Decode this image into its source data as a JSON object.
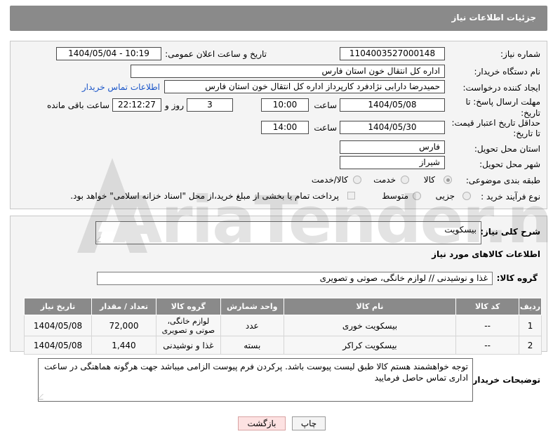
{
  "header": {
    "title": "جزئیات اطلاعات نیاز"
  },
  "fields": {
    "need_number_label": "شماره نیاز:",
    "need_number": "1104003527000148",
    "announce_label": "تاریخ و ساعت اعلان عمومی:",
    "announce_value": "1404/05/04 - 10:19",
    "buyer_org_label": "نام دستگاه خریدار:",
    "buyer_org": "اداره کل انتقال خون استان فارس",
    "creator_label": "ایجاد کننده درخواست:",
    "creator": "حمیدرضا دارابی نژادفرد کارپرداز اداره کل انتقال خون استان فارس",
    "contact_link": "اطلاعات تماس خریدار",
    "deadline_label_1": "مهلت ارسال پاسخ: تا",
    "deadline_label_2": "تاریخ:",
    "deadline_date": "1404/05/08",
    "time_label": "ساعت",
    "deadline_time": "10:00",
    "days_value": "3",
    "days_label": "روز و",
    "remaining_time": "22:12:27",
    "remaining_label": "ساعت باقی مانده",
    "min_validity_label_1": "حداقل تاریخ اعتبار قیمت:",
    "min_validity_label_2": "تا تاریخ:",
    "validity_date": "1404/05/30",
    "validity_time": "14:00",
    "province_label": "استان محل تحویل:",
    "province": "فارس",
    "city_label": "شهر محل تحویل:",
    "city": "شیراز",
    "category_label": "طبقه بندی موضوعی:",
    "category_options": [
      "کالا",
      "خدمت",
      "کالا/خدمت"
    ],
    "category_selected": "کالا",
    "process_label": "نوع فرآیند خرید :",
    "process_options": [
      "جزیی",
      "متوسط"
    ],
    "payment_note": "پرداخت تمام یا بخشی از مبلغ خرید،از محل \"اسناد خزانه اسلامی\" خواهد بود."
  },
  "description": {
    "label": "شرح کلی نیاز:",
    "value": "بیسکویت"
  },
  "goods_section": {
    "title": "اطلاعات کالاهای مورد نیاز",
    "group_label": "گروه کالا:",
    "group_value": "غذا و نوشیدنی // لوازم خانگی، صوتی و تصویری"
  },
  "table": {
    "headers": [
      "ردیف",
      "کد کالا",
      "نام کالا",
      "واحد شمارش",
      "گروه کالا",
      "تعداد / مقدار",
      "تاریخ نیاز"
    ],
    "rows": [
      [
        "1",
        "--",
        "بیسکویت خوری",
        "عدد",
        "لوازم خانگی، صوتی و تصویری",
        "72,000",
        "1404/05/08"
      ],
      [
        "2",
        "--",
        "بیسکویت کراکر",
        "بسته",
        "غذا و نوشیدنی",
        "1,440",
        "1404/05/08"
      ]
    ]
  },
  "buyer_notes": {
    "label": "توضیحات خریدار:",
    "value": "توجه خواهشمند هستم کالا طبق لیست پیوست باشد. پرکردن فرم پیوست الزامی میباشد جهت هرگونه هماهنگی در ساعت اداری تماس حاصل فرمایید"
  },
  "buttons": {
    "print": "چاپ",
    "back": "بازگشت"
  },
  "watermark": "AriaTender.neT",
  "colors": {
    "header_bg": "#8a8a8a",
    "link": "#1a55c8",
    "back_button_bg": "#fde2e2"
  }
}
